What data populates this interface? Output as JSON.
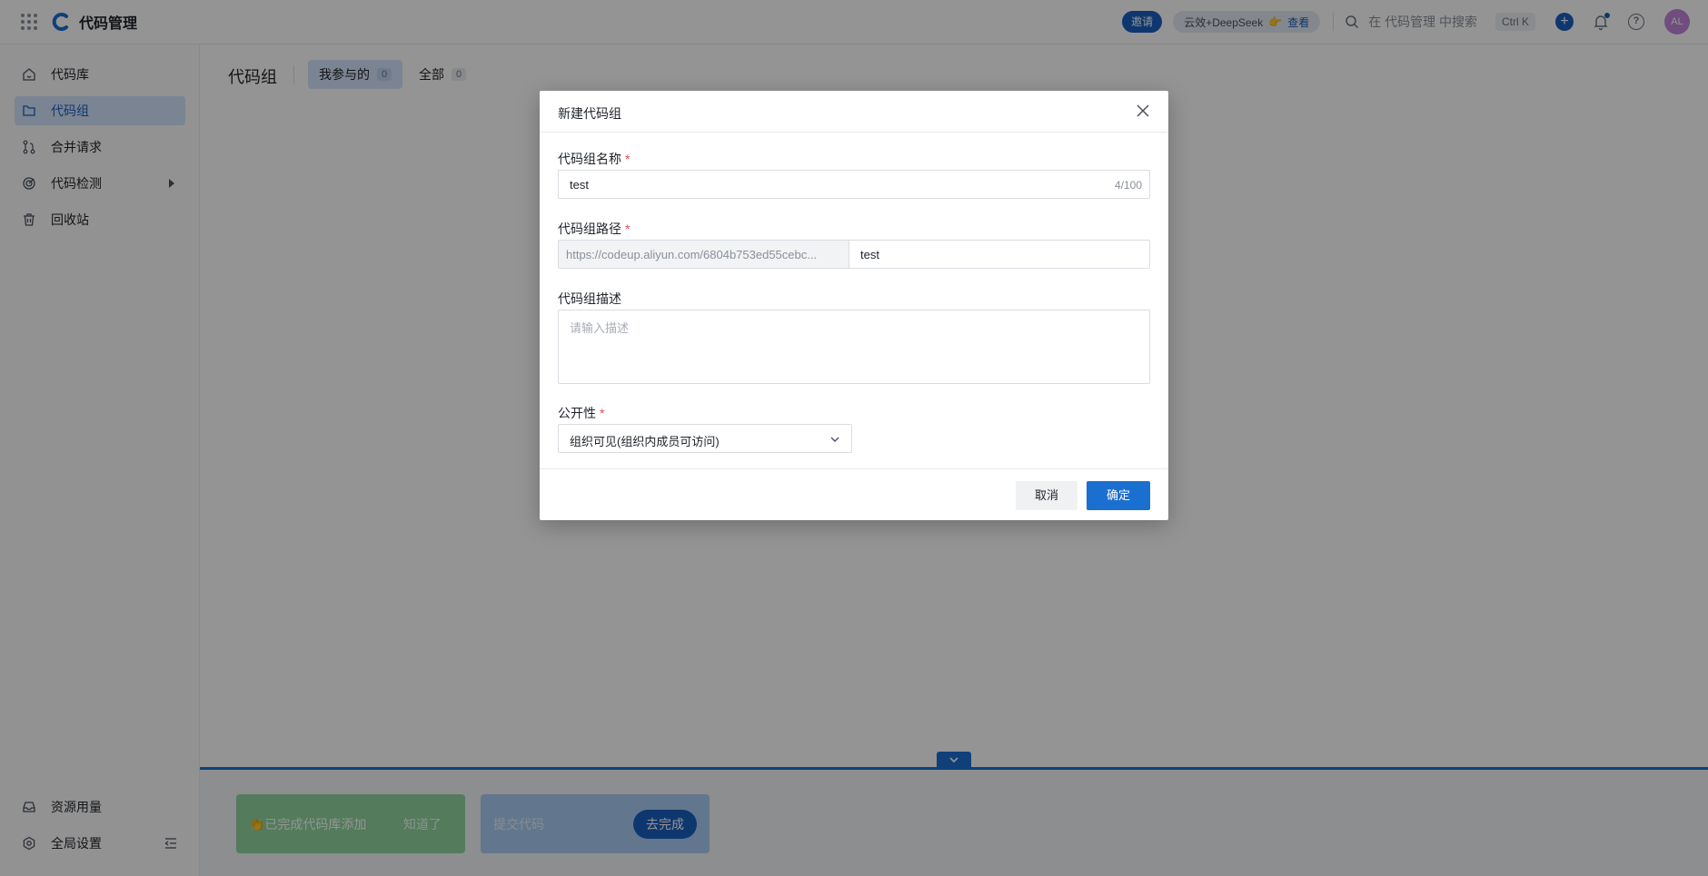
{
  "header": {
    "app_title": "代码管理",
    "invite_label": "邀请",
    "promo_text": "云效+DeepSeek",
    "promo_link": "查看",
    "search_placeholder": "在 代码管理 中搜索",
    "shortcut": "Ctrl K",
    "avatar_initials": "AL"
  },
  "sidebar": {
    "items": [
      {
        "label": "代码库",
        "icon": "home-icon"
      },
      {
        "label": "代码组",
        "icon": "folder-icon",
        "active": true
      },
      {
        "label": "合并请求",
        "icon": "merge-icon"
      },
      {
        "label": "代码检测",
        "icon": "scan-icon",
        "has_submenu": true
      },
      {
        "label": "回收站",
        "icon": "trash-icon"
      }
    ],
    "bottom_items": [
      {
        "label": "资源用量",
        "icon": "inbox-icon"
      },
      {
        "label": "全局设置",
        "icon": "settings-icon"
      }
    ]
  },
  "main": {
    "page_title": "代码组",
    "tabs": [
      {
        "label": "我参与的",
        "count": "0",
        "active": true
      },
      {
        "label": "全部",
        "count": "0",
        "active": false
      }
    ]
  },
  "guide": {
    "done_task": "👏已完成代码库添加",
    "done_action": "知道了",
    "todo_task": "提交代码",
    "todo_action": "去完成"
  },
  "dialog": {
    "title": "新建代码组",
    "name_label": "代码组名称",
    "name_value": "test",
    "name_count": "4/100",
    "path_label": "代码组路径",
    "path_prefix": "https://codeup.aliyun.com/6804b753ed55cebc...",
    "path_value": "test",
    "desc_label": "代码组描述",
    "desc_placeholder": "请输入描述",
    "visibility_label": "公开性",
    "visibility_value": "组织可见(组织内成员可访问)",
    "cancel_label": "取消",
    "ok_label": "确定"
  },
  "colors": {
    "primary": "#1b6fd1",
    "active_bg": "#d4e4fb",
    "required": "#e5484d",
    "task_done": "#8fd59f",
    "task_todo": "#a9cdf3"
  }
}
